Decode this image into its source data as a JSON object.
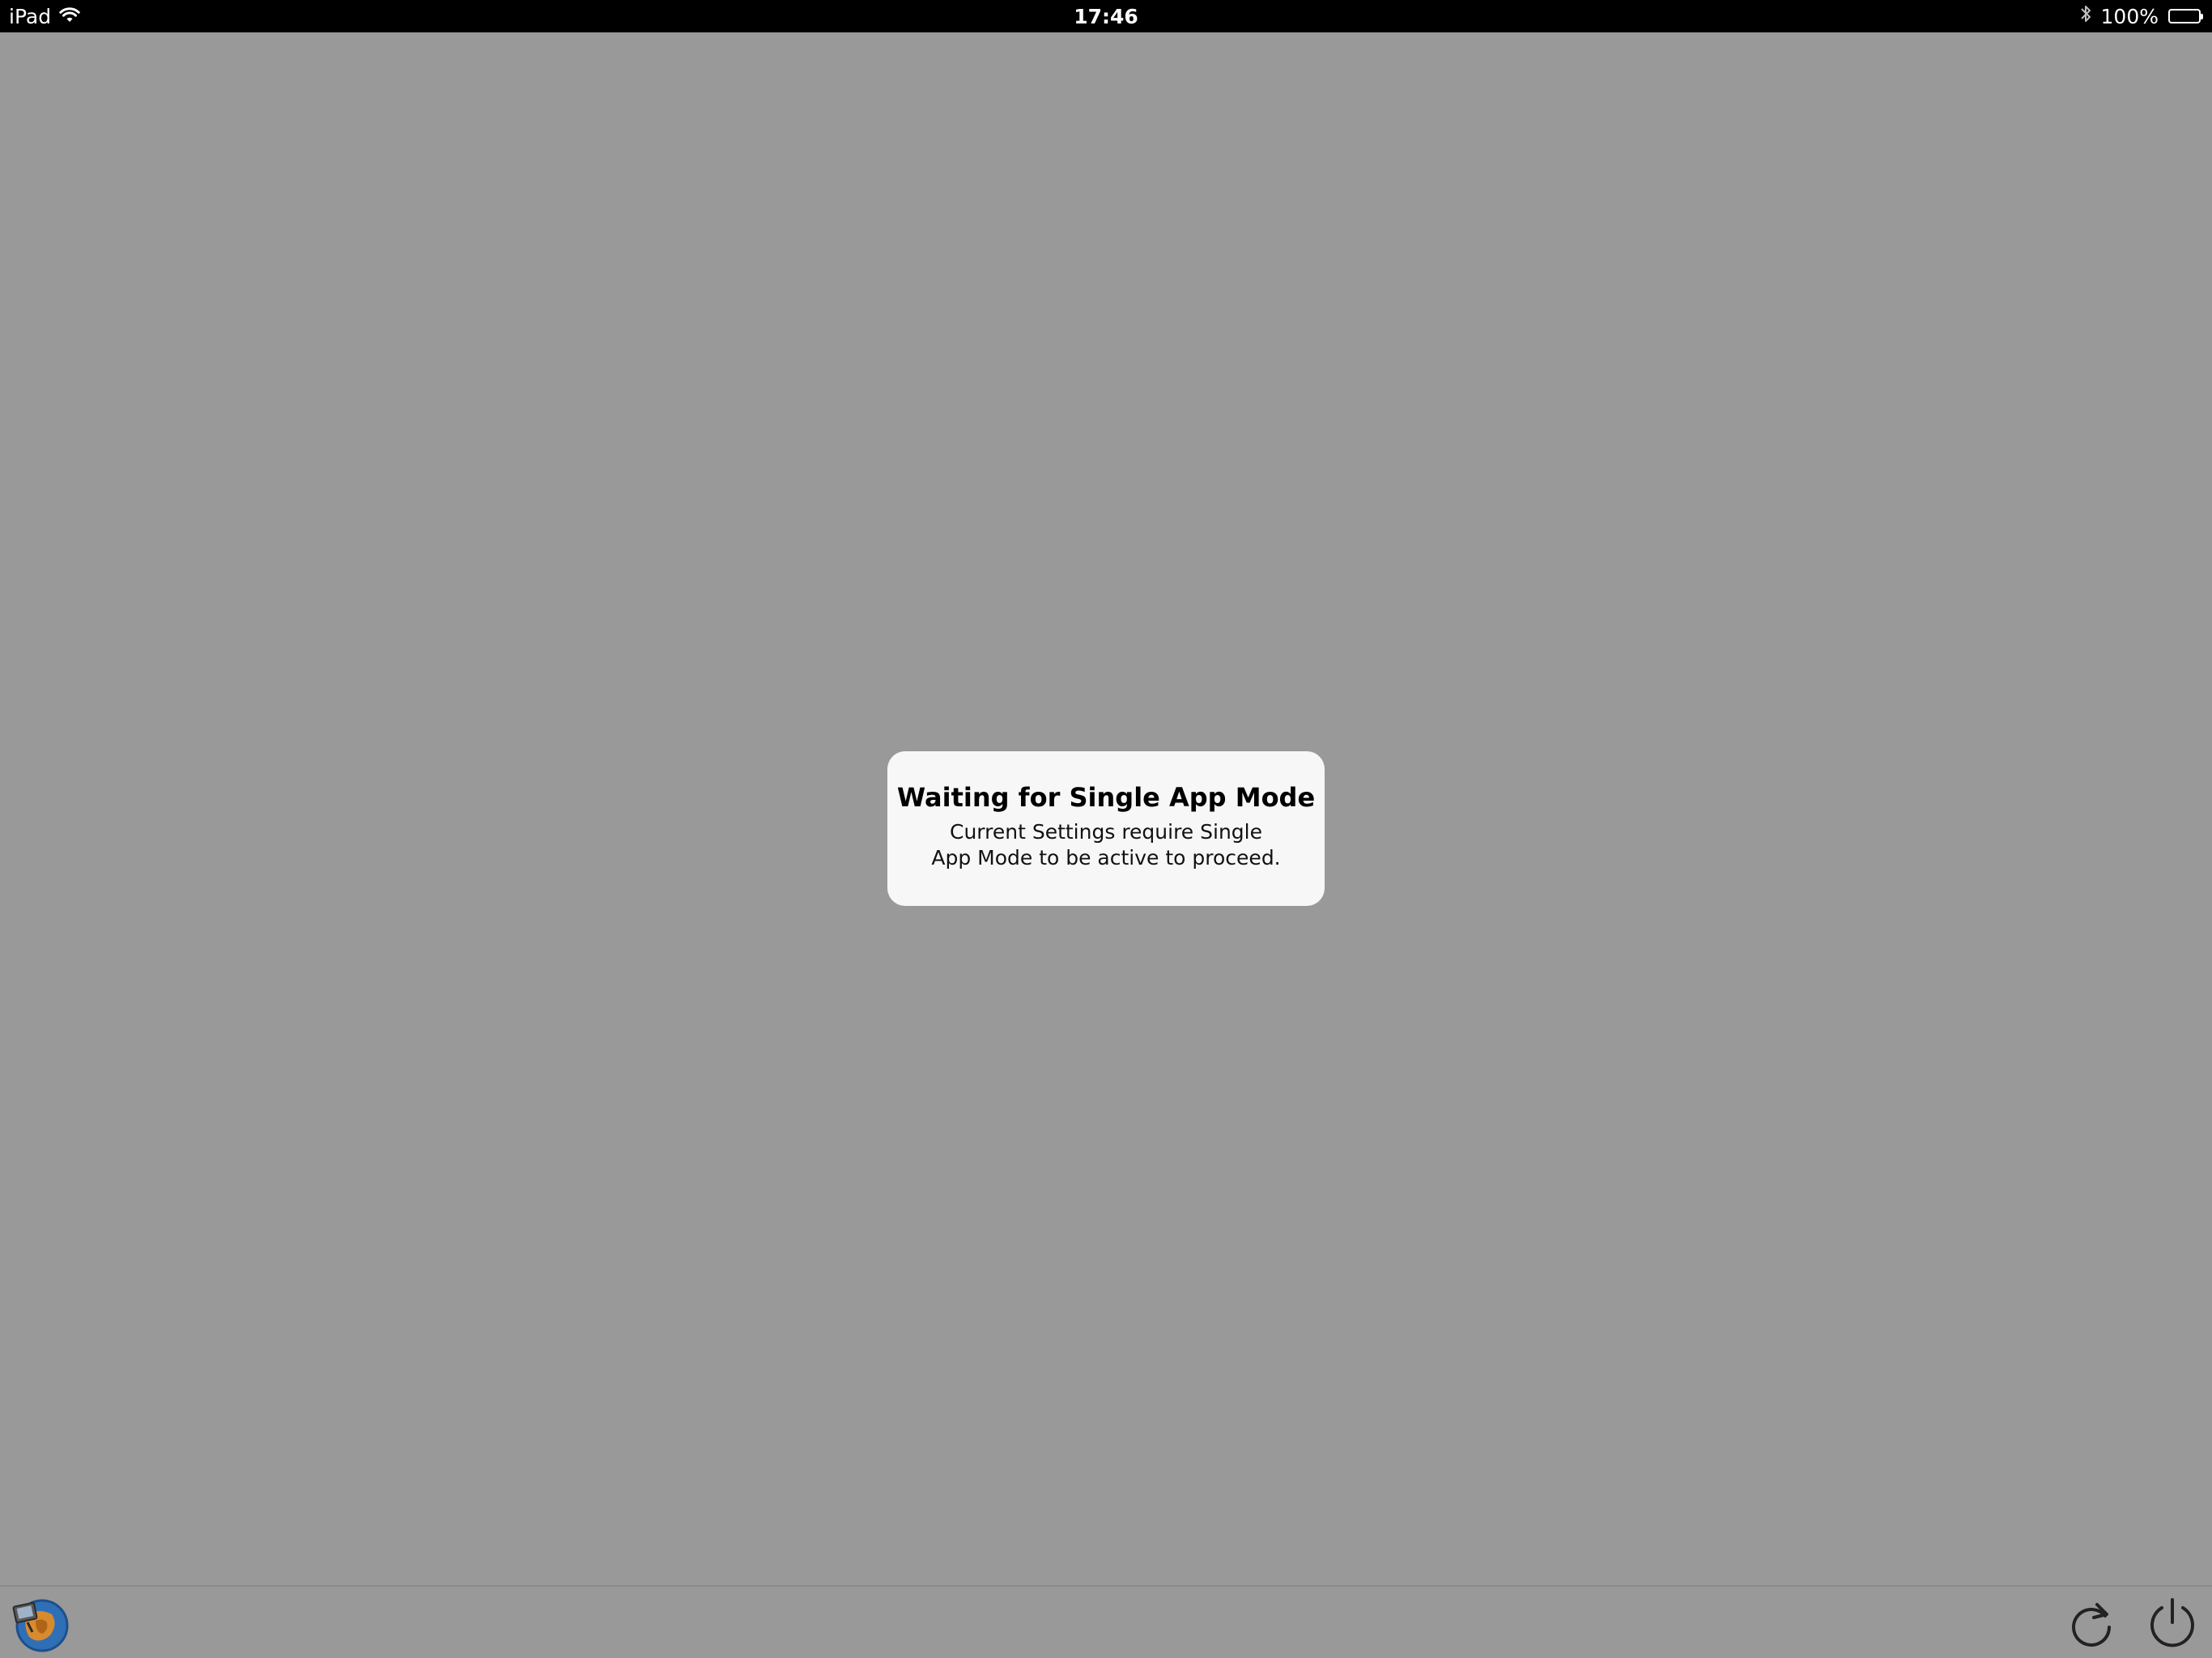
{
  "status_bar": {
    "device": "iPad",
    "time": "17:46",
    "battery_percent": "100%",
    "icons": [
      "wifi-icon",
      "bluetooth-icon",
      "battery-icon"
    ]
  },
  "dialog": {
    "title": "Waiting for Single App Mode",
    "message": "Current Settings require Single App Mode to be active to proceed."
  },
  "toolbar": {
    "icons": [
      "app-logo-icon",
      "reload-icon",
      "power-icon"
    ]
  },
  "colors": {
    "background": "#999999",
    "dialog": "#f7f7f7",
    "status_bar": "#000000"
  }
}
